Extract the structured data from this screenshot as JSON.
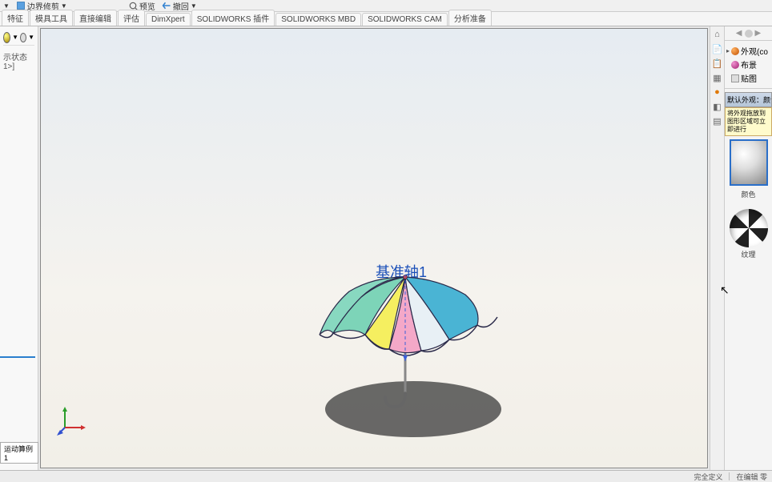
{
  "toolbar": {
    "trim_label": "边界修剪",
    "preview_label": "预览",
    "back_label": "撤回"
  },
  "tabs": [
    "特征",
    "模具工具",
    "直接编辑",
    "评估",
    "DimXpert",
    "SOLIDWORKS 插件",
    "SOLIDWORKS MBD",
    "SOLIDWORKS CAM",
    "分析准备"
  ],
  "left_panel": {
    "state_text": "示状态 1>]"
  },
  "viewport": {
    "axis_label": "基准轴1",
    "window_controls": [
      "⊟",
      "□",
      "×"
    ]
  },
  "task_tree": {
    "items": [
      {
        "icon_color": "#e07800",
        "label": "外观(co"
      },
      {
        "icon_color": "#c02070",
        "label": "布景"
      },
      {
        "icon_color": "#888",
        "label": "贴图"
      }
    ]
  },
  "appearance": {
    "header": "默认外观：颜色",
    "yellow_note": "将外观拖放到图形区域可立即进行",
    "swatch_label": "颜色",
    "checker_label": "纹理"
  },
  "bottom_tab": "运动算例1",
  "status": {
    "left_text": "完全定义",
    "right_text": "在编辑 零"
  }
}
